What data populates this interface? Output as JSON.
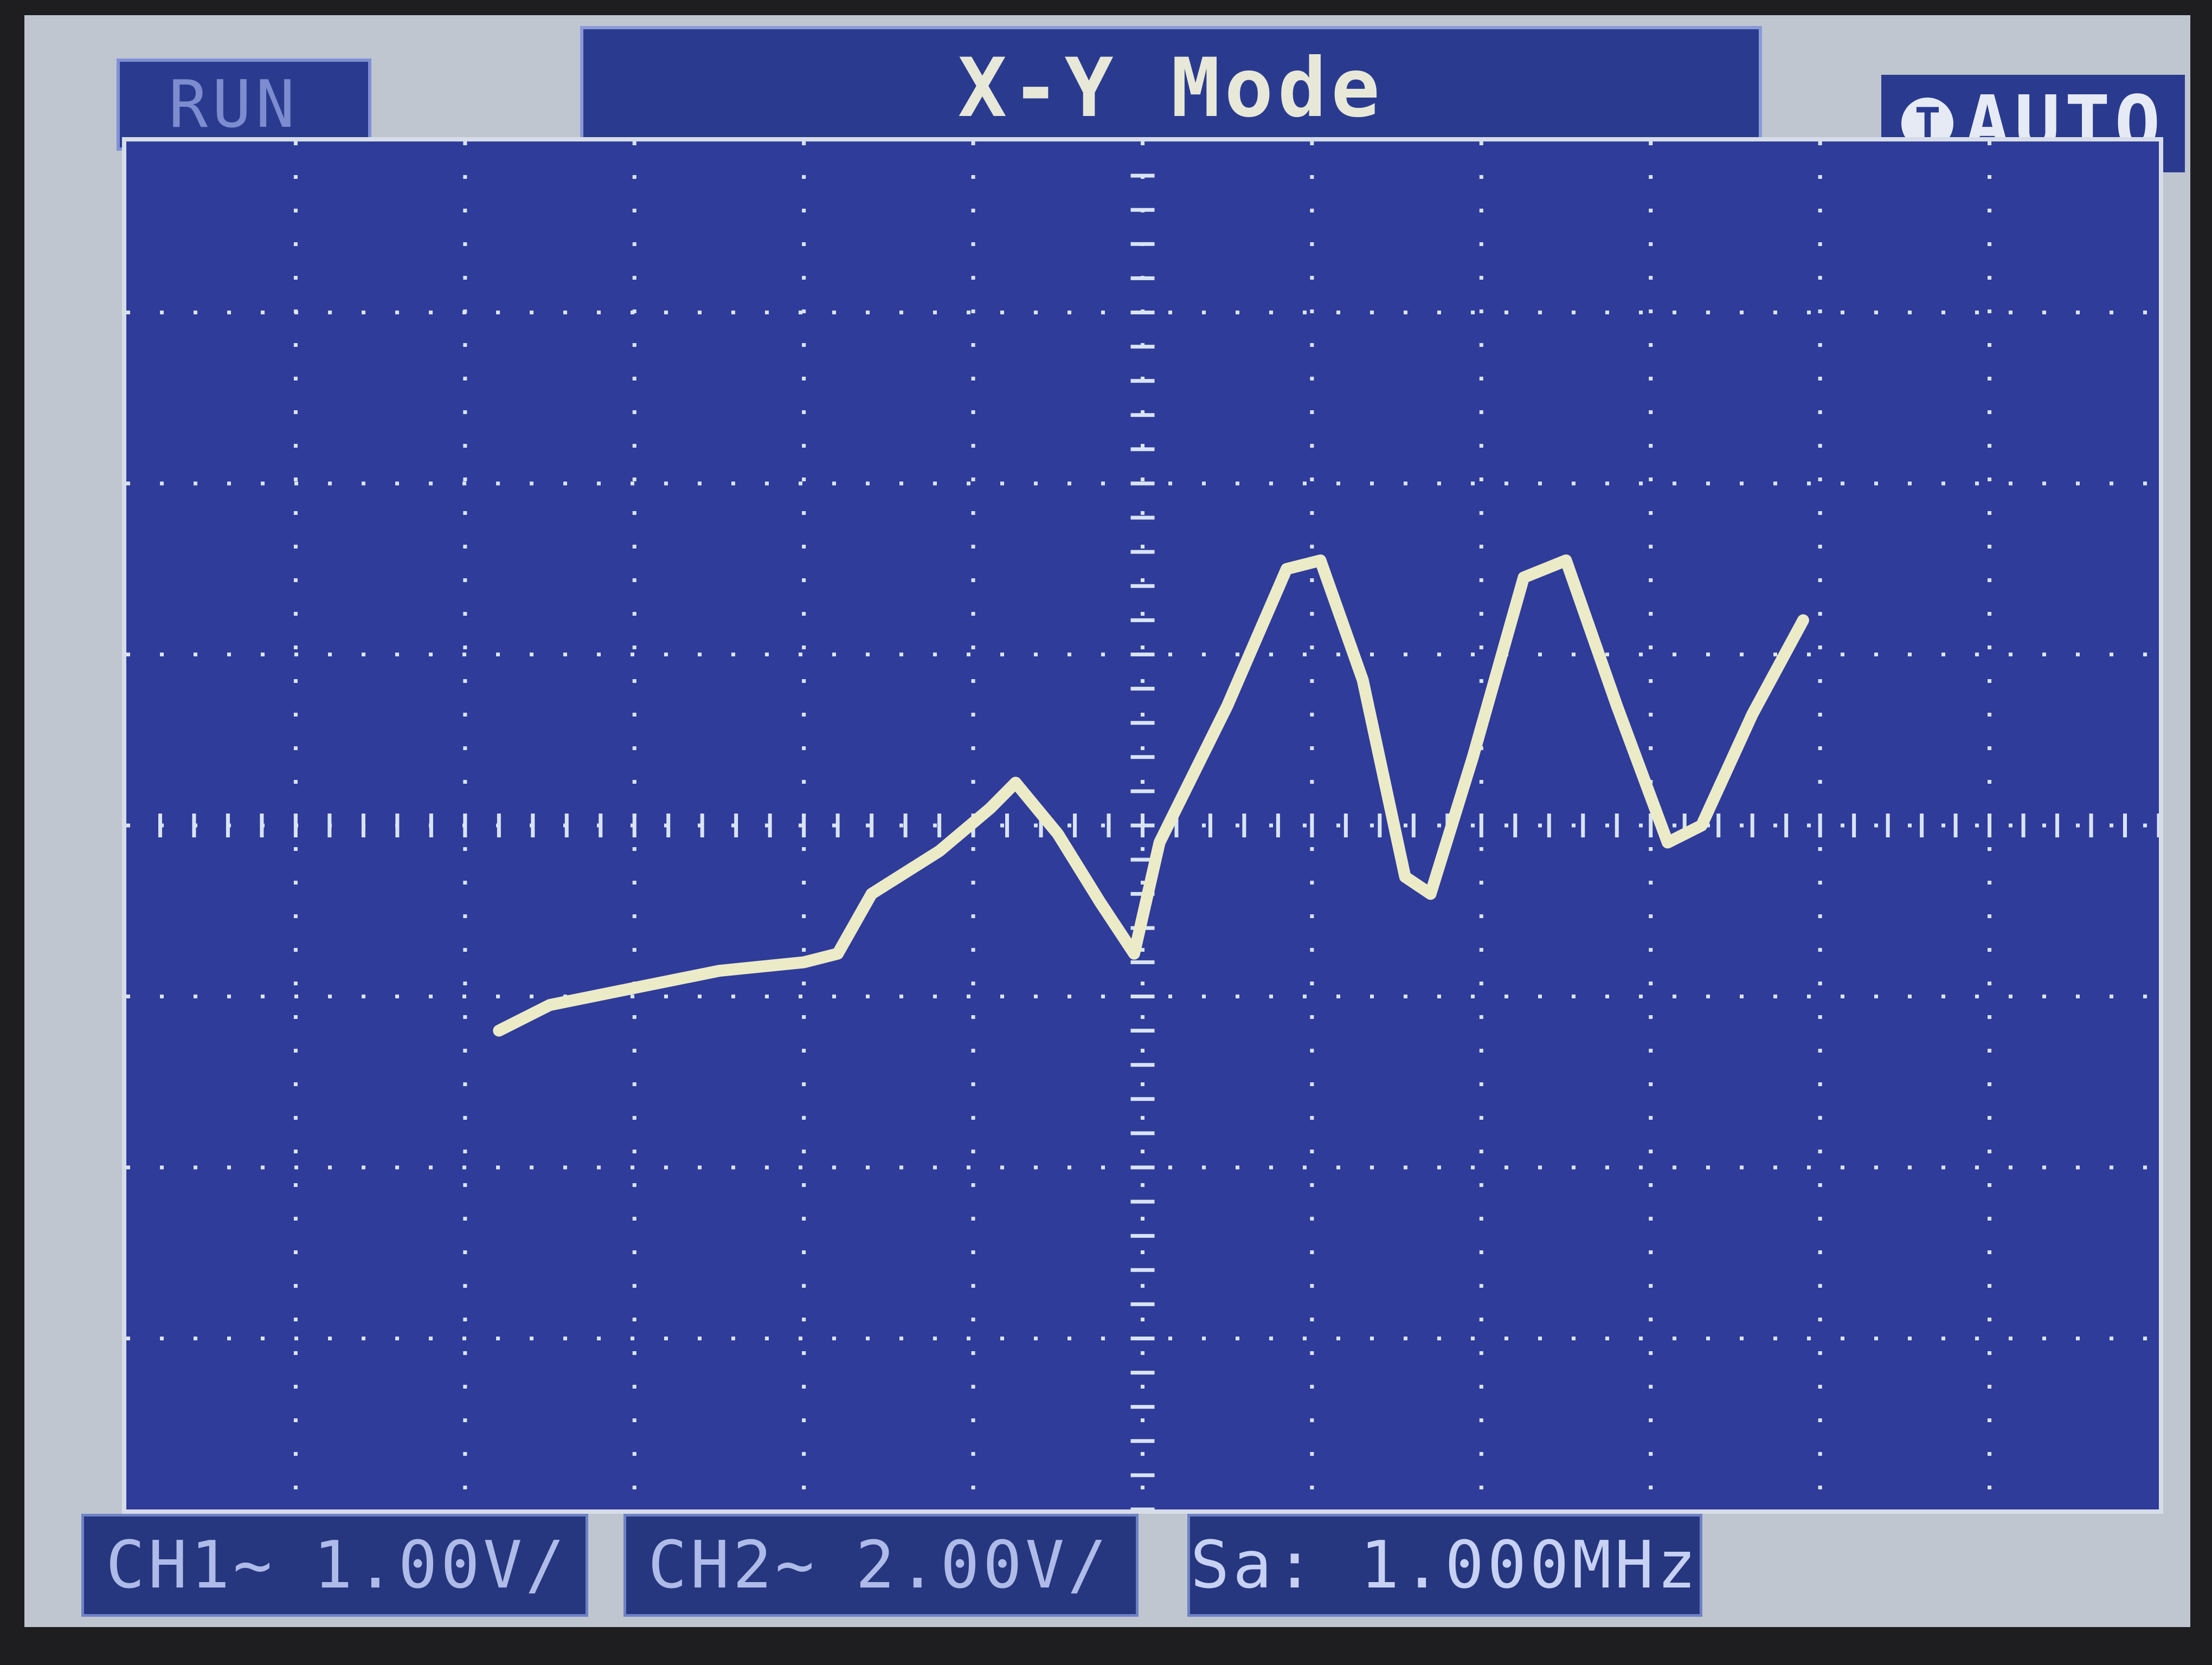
{
  "status": {
    "run_state": "RUN",
    "mode_title": "X-Y Mode",
    "trigger_icon": "T",
    "trigger_mode": "AUTO"
  },
  "channels": [
    {
      "name": "CH1",
      "coupling_icon": "~",
      "scale": "1.00V/"
    },
    {
      "name": "CH2",
      "coupling_icon": "~",
      "scale": "2.00V/"
    }
  ],
  "sample_rate": "Sa: 1.000MHz",
  "colors": {
    "screen_background": "#2f3c9a",
    "trace": "#ecebc7",
    "grid_dots": "#d8e4f5",
    "panel_background": "#2a3b8f"
  },
  "grid": {
    "horizontal_divisions": 12,
    "vertical_divisions": 8
  },
  "trace_xy": [
    [
      -3.8,
      -1.2
    ],
    [
      -3.5,
      -1.05
    ],
    [
      -3.0,
      -0.95
    ],
    [
      -2.5,
      -0.85
    ],
    [
      -2.0,
      -0.8
    ],
    [
      -1.8,
      -0.75
    ],
    [
      -1.6,
      -0.4
    ],
    [
      -1.2,
      -0.15
    ],
    [
      -0.9,
      0.1
    ],
    [
      -0.75,
      0.25
    ],
    [
      -0.5,
      -0.05
    ],
    [
      -0.25,
      -0.45
    ],
    [
      -0.05,
      -0.75
    ],
    [
      0.1,
      -0.1
    ],
    [
      0.5,
      0.7
    ],
    [
      0.85,
      1.5
    ],
    [
      1.05,
      1.55
    ],
    [
      1.3,
      0.85
    ],
    [
      1.55,
      -0.3
    ],
    [
      1.7,
      -0.4
    ],
    [
      1.95,
      0.4
    ],
    [
      2.25,
      1.45
    ],
    [
      2.5,
      1.55
    ],
    [
      2.8,
      0.7
    ],
    [
      3.1,
      -0.1
    ],
    [
      3.3,
      0.0
    ],
    [
      3.6,
      0.65
    ],
    [
      3.9,
      1.2
    ]
  ]
}
